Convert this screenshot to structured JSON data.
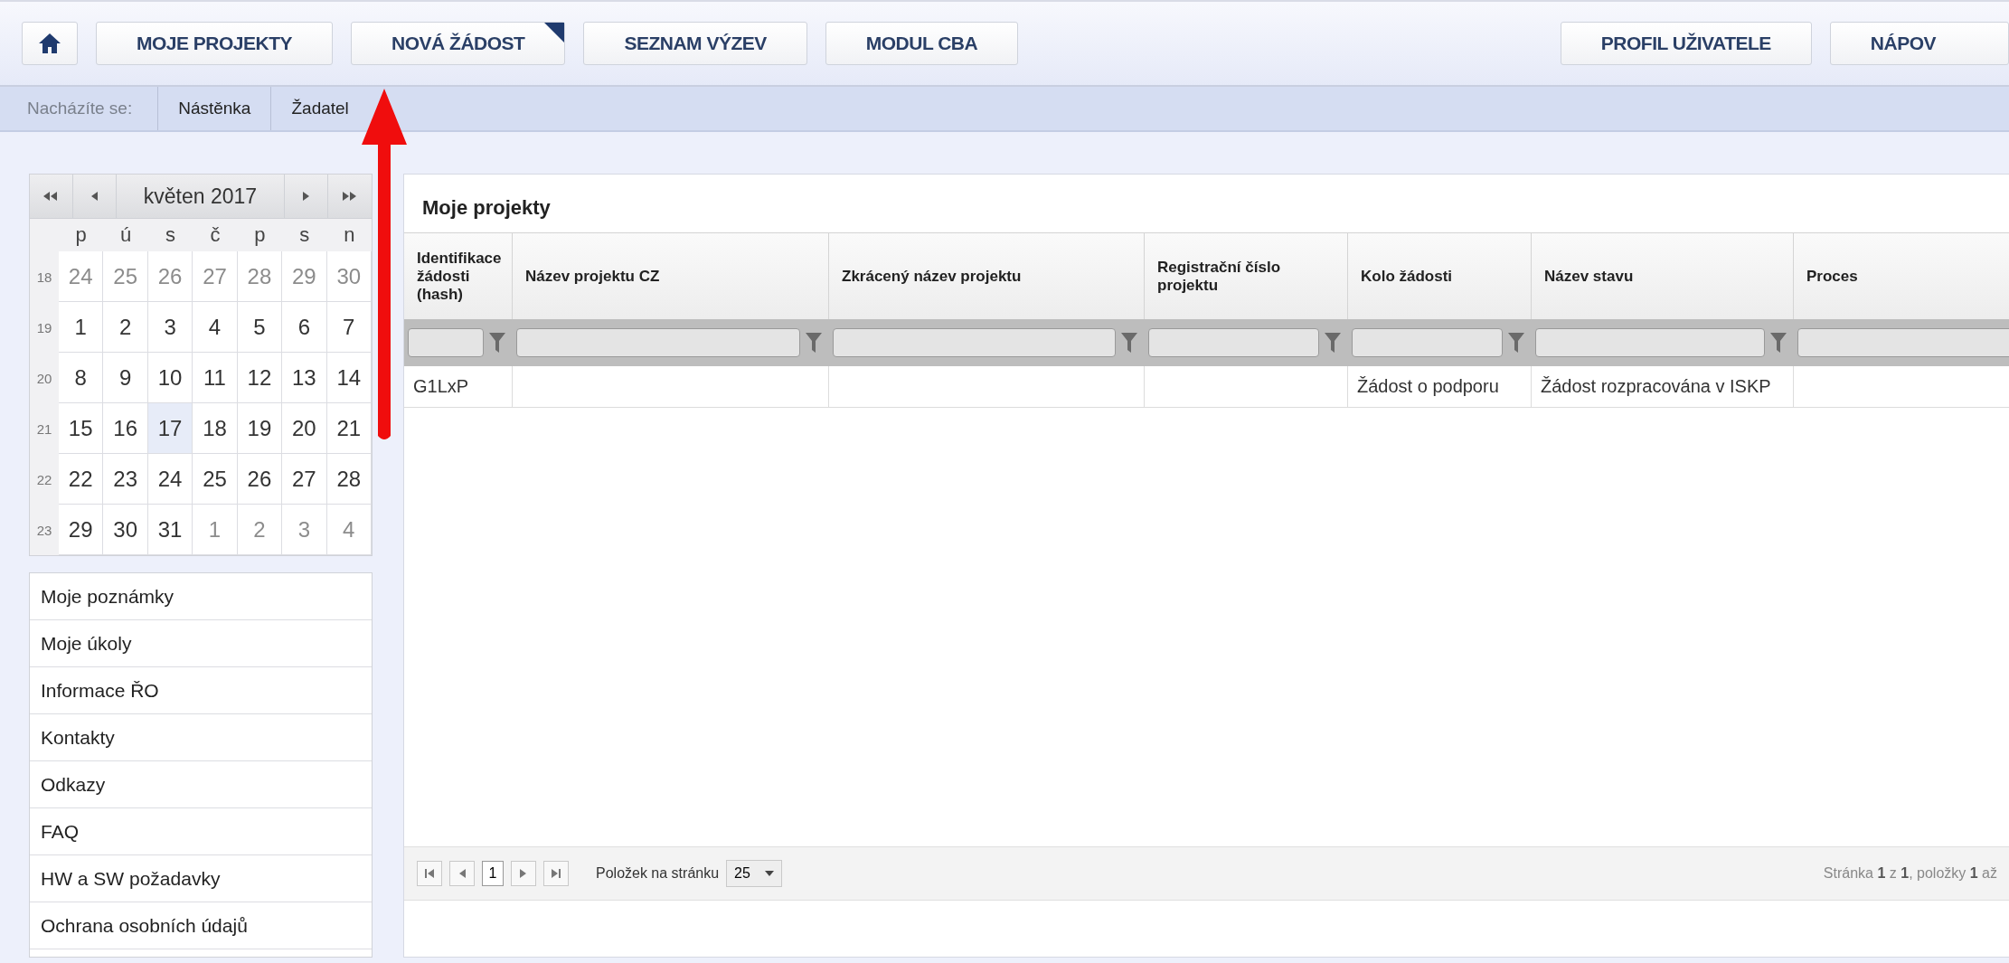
{
  "nav": {
    "left_buttons": [
      {
        "label": "MOJE PROJEKTY",
        "flagged": false
      },
      {
        "label": "NOVÁ ŽÁDOST",
        "flagged": true
      },
      {
        "label": "SEZNAM VÝZEV",
        "flagged": false
      },
      {
        "label": "MODUL CBA",
        "flagged": false
      }
    ],
    "right_buttons": [
      {
        "label": "PROFIL UŽIVATELE",
        "flagged": false
      },
      {
        "label": "NÁPOV",
        "flagged": false
      }
    ]
  },
  "breadcrumb": {
    "label": "Nacházíte se:",
    "items": [
      "Nástěnka",
      "Žadatel"
    ]
  },
  "calendar": {
    "month": "květen 2017",
    "weekdays": [
      "p",
      "ú",
      "s",
      "č",
      "p",
      "s",
      "n"
    ],
    "weeks": [
      {
        "number": "18",
        "days": [
          {
            "day": "24",
            "other_month": true,
            "selected": false
          },
          {
            "day": "25",
            "other_month": true,
            "selected": false
          },
          {
            "day": "26",
            "other_month": true,
            "selected": false
          },
          {
            "day": "27",
            "other_month": true,
            "selected": false
          },
          {
            "day": "28",
            "other_month": true,
            "selected": false
          },
          {
            "day": "29",
            "other_month": true,
            "selected": false
          },
          {
            "day": "30",
            "other_month": true,
            "selected": false
          }
        ]
      },
      {
        "number": "19",
        "days": [
          {
            "day": "1",
            "other_month": false,
            "selected": false
          },
          {
            "day": "2",
            "other_month": false,
            "selected": false
          },
          {
            "day": "3",
            "other_month": false,
            "selected": false
          },
          {
            "day": "4",
            "other_month": false,
            "selected": false
          },
          {
            "day": "5",
            "other_month": false,
            "selected": false
          },
          {
            "day": "6",
            "other_month": false,
            "selected": false
          },
          {
            "day": "7",
            "other_month": false,
            "selected": false
          }
        ]
      },
      {
        "number": "20",
        "days": [
          {
            "day": "8",
            "other_month": false,
            "selected": false
          },
          {
            "day": "9",
            "other_month": false,
            "selected": false
          },
          {
            "day": "10",
            "other_month": false,
            "selected": false
          },
          {
            "day": "11",
            "other_month": false,
            "selected": false
          },
          {
            "day": "12",
            "other_month": false,
            "selected": false
          },
          {
            "day": "13",
            "other_month": false,
            "selected": false
          },
          {
            "day": "14",
            "other_month": false,
            "selected": false
          }
        ]
      },
      {
        "number": "21",
        "days": [
          {
            "day": "15",
            "other_month": false,
            "selected": false
          },
          {
            "day": "16",
            "other_month": false,
            "selected": false
          },
          {
            "day": "17",
            "other_month": false,
            "selected": true
          },
          {
            "day": "18",
            "other_month": false,
            "selected": false
          },
          {
            "day": "19",
            "other_month": false,
            "selected": false
          },
          {
            "day": "20",
            "other_month": false,
            "selected": false
          },
          {
            "day": "21",
            "other_month": false,
            "selected": false
          }
        ]
      },
      {
        "number": "22",
        "days": [
          {
            "day": "22",
            "other_month": false,
            "selected": false
          },
          {
            "day": "23",
            "other_month": false,
            "selected": false
          },
          {
            "day": "24",
            "other_month": false,
            "selected": false
          },
          {
            "day": "25",
            "other_month": false,
            "selected": false
          },
          {
            "day": "26",
            "other_month": false,
            "selected": false
          },
          {
            "day": "27",
            "other_month": false,
            "selected": false
          },
          {
            "day": "28",
            "other_month": false,
            "selected": false
          }
        ]
      },
      {
        "number": "23",
        "days": [
          {
            "day": "29",
            "other_month": false,
            "selected": false
          },
          {
            "day": "30",
            "other_month": false,
            "selected": false
          },
          {
            "day": "31",
            "other_month": false,
            "selected": false
          },
          {
            "day": "1",
            "other_month": true,
            "selected": false
          },
          {
            "day": "2",
            "other_month": true,
            "selected": false
          },
          {
            "day": "3",
            "other_month": true,
            "selected": false
          },
          {
            "day": "4",
            "other_month": true,
            "selected": false
          }
        ]
      }
    ]
  },
  "menu": [
    "Moje poznámky",
    "Moje úkoly",
    "Informace ŘO",
    "Kontakty",
    "Odkazy",
    "FAQ",
    "HW a SW požadavky",
    "Ochrana osobních údajů"
  ],
  "table": {
    "title": "Moje projekty",
    "columns": [
      "Identifikace žádosti (hash)",
      "Název projektu CZ",
      "Zkrácený název projektu",
      "Registrační číslo projektu",
      "Kolo žádosti",
      "Název stavu",
      "Proces"
    ],
    "rows": [
      {
        "cells": [
          "G1LxP",
          "",
          "",
          "",
          "Žádost o podporu",
          "Žádost rozpracována v ISKP",
          ""
        ]
      }
    ]
  },
  "pagination": {
    "page": "1",
    "page_size_label": "Položek na stránku",
    "page_size": "25",
    "summary": "Stránka **1** z **1**, položky **1** až"
  }
}
